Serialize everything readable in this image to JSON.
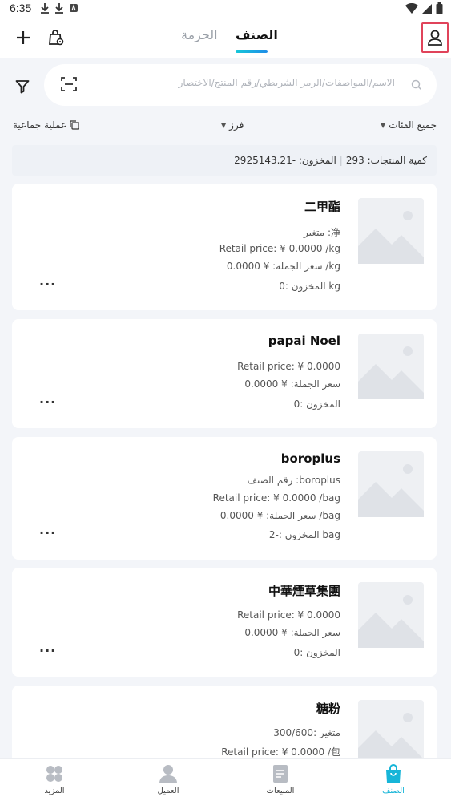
{
  "status_bar": {
    "time": "6:35"
  },
  "tabs": {
    "bundle": "الحزمة",
    "category": "الصنف"
  },
  "search": {
    "placeholder": "الاسم/المواصفات/الرمز الشريطي/رقم المنتج/الاختصار"
  },
  "toolbar": {
    "bulk_label": "عملية جماعية",
    "sort_label": "فرز",
    "all_categories_label": "جميع الفئات"
  },
  "summary": {
    "count_label": "كمية المنتجات: 293",
    "stock_label": "المخزون: -2925143.21"
  },
  "products": [
    {
      "name": "二甲酯",
      "lines": [
        "متغير :净",
        "Retail price: ¥ 0.0000 /kg",
        "سعر الجملة: ¥ 0.0000 /kg",
        "المخزون :0 kg"
      ]
    },
    {
      "name": "papai Noel",
      "lines": [
        "Retail price: ¥ 0.0000",
        "سعر الجملة: ¥ 0.0000",
        "المخزون :0"
      ]
    },
    {
      "name": "boroplus",
      "lines": [
        "رقم الصنف :boroplus",
        "Retail price: ¥ 0.0000 /bag",
        "سعر الجملة: ¥ 0.0000 /bag",
        "المخزون :-2 bag"
      ]
    },
    {
      "name": "中華煙草集團",
      "lines": [
        "Retail price: ¥ 0.0000",
        "سعر الجملة: ¥ 0.0000",
        "المخزون :0"
      ]
    },
    {
      "name": "糖粉",
      "lines": [
        "متغير :300/600",
        "Retail price: ¥ 0.0000 /包"
      ]
    }
  ],
  "more_label": "...",
  "bottom_nav": {
    "more": "المزيد",
    "customer": "العميل",
    "sales": "المبيعات",
    "category": "الصنف"
  },
  "colors": {
    "accent": "#17b5d8",
    "highlight": "#e0435a"
  }
}
